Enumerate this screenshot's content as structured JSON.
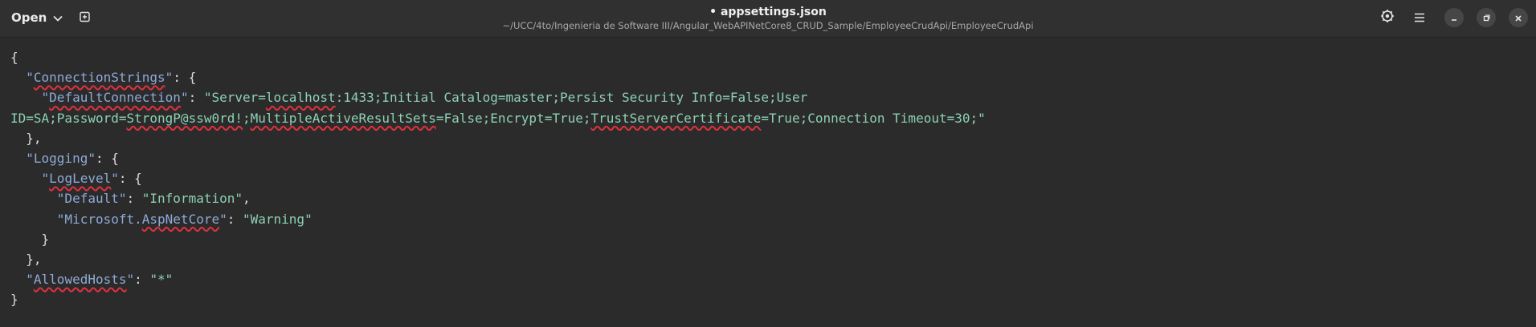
{
  "header": {
    "open_label": "Open",
    "title": "• appsettings.json",
    "path": "~/UCC/4to/Ingenieria de Software III/Angular_WebAPINetCore8_CRUD_Sample/EmployeeCrudApi/EmployeeCrudApi",
    "icons": [
      "chevron-down-icon",
      "new-tab-icon",
      "gear-icon",
      "hamburger-menu-icon",
      "minimize-icon",
      "restore-icon",
      "close-icon"
    ]
  },
  "editor": {
    "lines": {
      "l1": "{",
      "l2": {
        "indent": "  ",
        "key": "\"ConnectionStrings\"",
        "sep": ": {"
      },
      "l3": {
        "indent": "    ",
        "key_q": "\"",
        "key": "DefaultConnection",
        "key_q2": "\"",
        "sep": ": ",
        "v1": "\"Server=",
        "v2": "localhost",
        "v3": ":1433;Initial Catalog=master;Persist Security Info=False;User"
      },
      "l4": {
        "v1": "ID=SA;Password=",
        "v2": "StrongP@ssw0rd!",
        "v3": ";",
        "v4": "MultipleActiveResultSets",
        "v5": "=False;Encrypt=True;",
        "v6": "TrustServerCertificate",
        "v7": "=True;Connection Timeout=30;\""
      },
      "l5": "  },",
      "l6": {
        "indent": "  ",
        "key": "\"Logging\"",
        "sep": ": {"
      },
      "l7": {
        "indent": "    ",
        "key_q": "\"",
        "key": "LogLevel",
        "key_q2": "\"",
        "sep": ": {"
      },
      "l8": {
        "indent": "      ",
        "key": "\"Default\"",
        "sep": ": ",
        "val": "\"Information\"",
        "end": ","
      },
      "l9": {
        "indent": "      ",
        "key_a": "\"Microsoft.",
        "key_b": "AspNetCore",
        "key_c": "\"",
        "sep": ": ",
        "val": "\"Warning\""
      },
      "l10": "    }",
      "l11": "  },",
      "l12": {
        "indent": "  ",
        "key_q": "\"",
        "key": "AllowedHosts",
        "key_q2": "\"",
        "sep": ": ",
        "val": "\"*\""
      },
      "l13": "}"
    }
  },
  "colors": {
    "background": "#2b2b2b",
    "key": "#8fa9d6",
    "string": "#8ed1b4",
    "spellcheck": "#e0313f"
  }
}
